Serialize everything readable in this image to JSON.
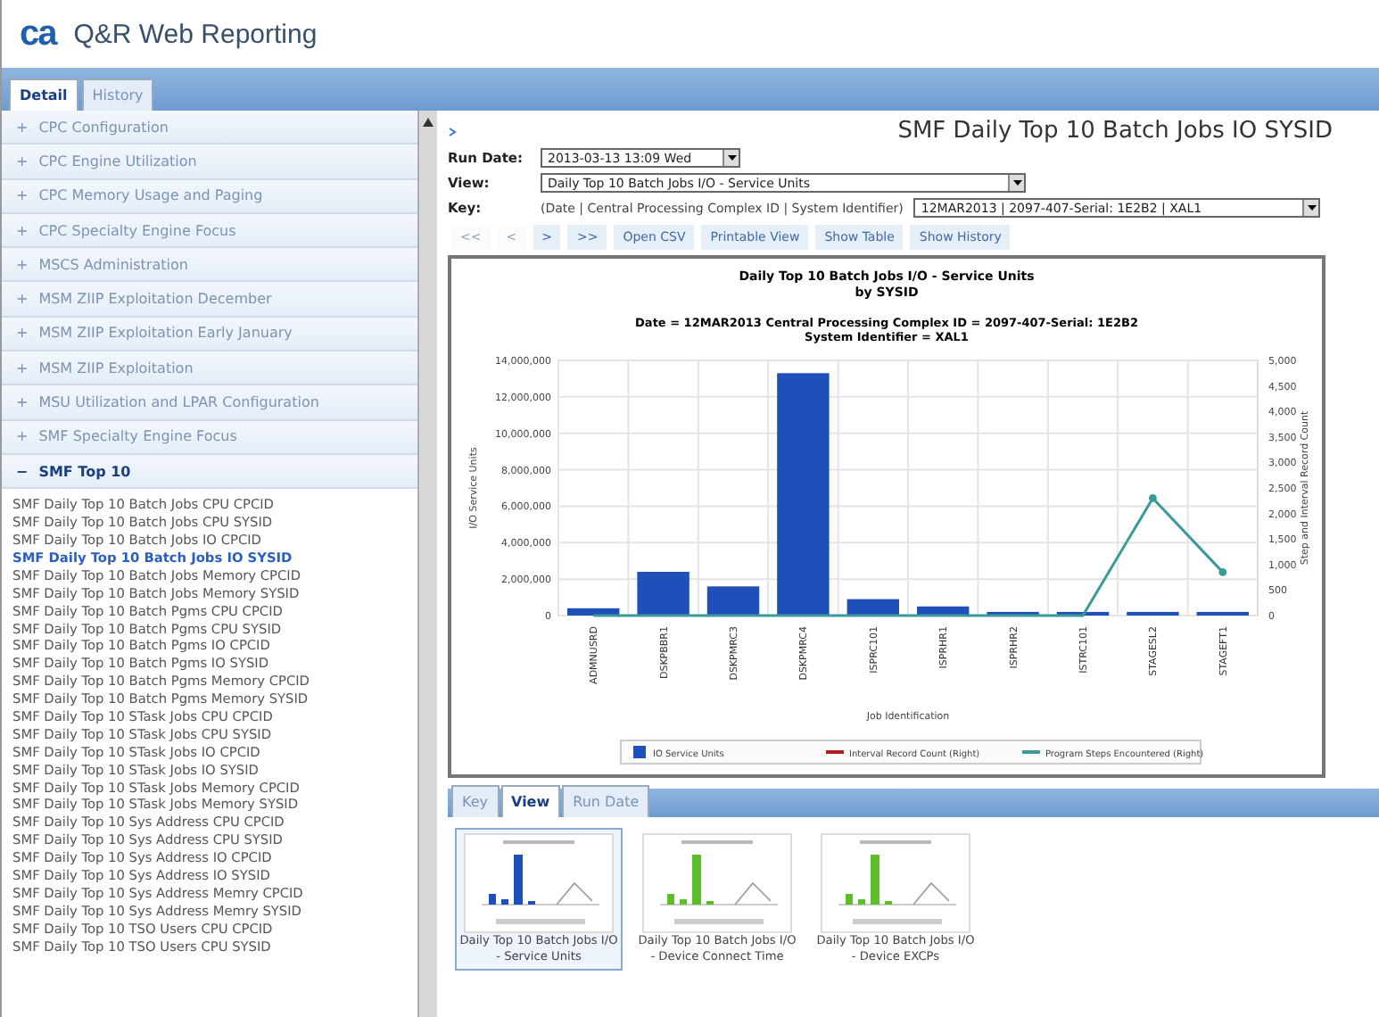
{
  "app": {
    "title": "Q&R Web Reporting",
    "logo": "ca"
  },
  "main_tabs": [
    {
      "label": "Detail",
      "selected": true
    },
    {
      "label": "History",
      "selected": false
    }
  ],
  "sidebar": {
    "groups": [
      {
        "label": "CPC Configuration",
        "expanded": false,
        "marker": "+"
      },
      {
        "label": "CPC Engine Utilization",
        "expanded": false,
        "marker": "+"
      },
      {
        "label": "CPC Memory Usage and Paging",
        "expanded": false,
        "marker": "+"
      },
      {
        "label": "CPC Specialty Engine Focus",
        "expanded": false,
        "marker": "+"
      },
      {
        "label": "MSCS Administration",
        "expanded": false,
        "marker": "+"
      },
      {
        "label": "MSM ZIIP Exploitation December",
        "expanded": false,
        "marker": "+"
      },
      {
        "label": "MSM ZIIP Exploitation Early January",
        "expanded": false,
        "marker": "+"
      },
      {
        "label": "MSM ZIIP Exploitation",
        "expanded": false,
        "marker": "+"
      },
      {
        "label": "MSU Utilization and LPAR Configuration",
        "expanded": false,
        "marker": "+"
      },
      {
        "label": "SMF Specialty Engine Focus",
        "expanded": false,
        "marker": "+"
      },
      {
        "label": "SMF Top 10",
        "expanded": true,
        "marker": "−",
        "children": [
          {
            "label": "SMF Daily Top 10 Batch Jobs CPU CPCID",
            "selected": false
          },
          {
            "label": "SMF Daily Top 10 Batch Jobs CPU SYSID",
            "selected": false
          },
          {
            "label": "SMF Daily Top 10 Batch Jobs IO CPCID",
            "selected": false
          },
          {
            "label": "SMF Daily Top 10 Batch Jobs IO SYSID",
            "selected": true
          },
          {
            "label": "SMF Daily Top 10 Batch Jobs Memory CPCID",
            "selected": false
          },
          {
            "label": "SMF Daily Top 10 Batch Jobs Memory SYSID",
            "selected": false
          },
          {
            "label": "SMF Daily Top 10 Batch Pgms CPU CPCID",
            "selected": false
          },
          {
            "label": "SMF Daily Top 10 Batch Pgms CPU SYSID",
            "selected": false
          },
          {
            "label": "SMF Daily Top 10 Batch Pgms IO CPCID",
            "selected": false
          },
          {
            "label": "SMF Daily Top 10 Batch Pgms IO SYSID",
            "selected": false
          },
          {
            "label": "SMF Daily Top 10 Batch Pgms Memory CPCID",
            "selected": false
          },
          {
            "label": "SMF Daily Top 10 Batch Pgms Memory SYSID",
            "selected": false
          },
          {
            "label": "SMF Daily Top 10 STask Jobs CPU CPCID",
            "selected": false
          },
          {
            "label": "SMF Daily Top 10 STask Jobs CPU SYSID",
            "selected": false
          },
          {
            "label": "SMF Daily Top 10 STask Jobs IO CPCID",
            "selected": false
          },
          {
            "label": "SMF Daily Top 10 STask Jobs IO SYSID",
            "selected": false
          },
          {
            "label": "SMF Daily Top 10 STask Jobs Memory CPCID",
            "selected": false
          },
          {
            "label": "SMF Daily Top 10 STask Jobs Memory SYSID",
            "selected": false
          },
          {
            "label": "SMF Daily Top 10 Sys Address CPU CPCID",
            "selected": false
          },
          {
            "label": "SMF Daily Top 10 Sys Address CPU SYSID",
            "selected": false
          },
          {
            "label": "SMF Daily Top 10 Sys Address IO CPCID",
            "selected": false
          },
          {
            "label": "SMF Daily Top 10 Sys Address IO SYSID",
            "selected": false
          },
          {
            "label": "SMF Daily Top 10 Sys Address Memry CPCID",
            "selected": false
          },
          {
            "label": "SMF Daily Top 10 Sys Address Memry SYSID",
            "selected": false
          },
          {
            "label": "SMF Daily Top 10 TSO Users CPU CPCID",
            "selected": false
          },
          {
            "label": "SMF Daily Top 10 TSO Users CPU SYSID",
            "selected": false
          }
        ]
      }
    ]
  },
  "report": {
    "title": "SMF Daily Top 10 Batch Jobs IO SYSID",
    "run_date": {
      "label": "Run Date:",
      "value": "2013-03-13 13:09 Wed"
    },
    "view": {
      "label": "View:",
      "value": "Daily Top 10 Batch Jobs I/O - Service Units"
    },
    "key": {
      "label": "Key:",
      "hint": "(Date | Central Processing Complex ID | System Identifier)",
      "value": "12MAR2013 | 2097-407-Serial: 1E2B2 | XAL1"
    },
    "toolbar": [
      {
        "label": "<<",
        "disabled": true
      },
      {
        "label": "<",
        "disabled": true
      },
      {
        "label": ">",
        "disabled": false
      },
      {
        "label": ">>",
        "disabled": false
      },
      {
        "label": "Open CSV",
        "disabled": false
      },
      {
        "label": "Printable View",
        "disabled": false
      },
      {
        "label": "Show Table",
        "disabled": false
      },
      {
        "label": "Show History",
        "disabled": false
      }
    ],
    "chart": {
      "chart_data": {
        "type": "bar",
        "title": "Daily Top 10 Batch Jobs I/O - Service Units\nby SYSID",
        "subtitle": "Date = 12MAR2013 Central Processing Complex ID = 2097-407-Serial: 1E2B2\nSystem Identifier = XAL1",
        "xlabel": "Job Identification",
        "ylabel": "I/O Service Units",
        "y2label": "Step and Interval Record Count",
        "categories": [
          "ADMNUSRD",
          "DSKPBBR1",
          "DSKPMRC3",
          "DSKPMRC4",
          "ISPRC101",
          "ISPRHR1",
          "ISPRHR2",
          "ISTRC101",
          "STAGESL2",
          "STAGEFT1"
        ],
        "series": [
          {
            "name": "IO Service Units",
            "color": "#1f4fb8",
            "values": [
              400000,
              2400000,
              1600000,
              13300000,
              900000,
              500000,
              200000,
              200000,
              200000,
              200000
            ]
          },
          {
            "name": "Interval Record Count (Right)",
            "color": "#b02020",
            "type": "line",
            "axis": "y2",
            "values": [
              null,
              null,
              null,
              null,
              null,
              null,
              null,
              null,
              null,
              null
            ]
          },
          {
            "name": "Program Steps Encountered (Right)",
            "color": "#3a9a9a",
            "type": "line",
            "axis": "y2",
            "values": [
              0,
              0,
              0,
              0,
              0,
              0,
              0,
              0,
              2300,
              850
            ]
          }
        ],
        "grid": true,
        "legend": true,
        "ylim": [
          0,
          14000000
        ],
        "y2lim": [
          0,
          5000
        ],
        "yticks": [
          {
            "value": 0,
            "label": "0"
          },
          {
            "value": 2000000,
            "label": "2,000,000"
          },
          {
            "value": 4000000,
            "label": "4,000,000"
          },
          {
            "value": 6000000,
            "label": "6,000,000"
          },
          {
            "value": 8000000,
            "label": "8,000,000"
          },
          {
            "value": 10000000,
            "label": "10,000,000"
          },
          {
            "value": 12000000,
            "label": "12,000,000"
          },
          {
            "value": 14000000,
            "label": "14,000,000"
          }
        ],
        "y2ticks": [
          {
            "value": 0,
            "label": "0"
          },
          {
            "value": 500,
            "label": "500"
          },
          {
            "value": 1000,
            "label": "1,000"
          },
          {
            "value": 1500,
            "label": "1,500"
          },
          {
            "value": 2000,
            "label": "2,000"
          },
          {
            "value": 2500,
            "label": "2,500"
          },
          {
            "value": 3000,
            "label": "3,000"
          },
          {
            "value": 3500,
            "label": "3,500"
          },
          {
            "value": 4000,
            "label": "4,000"
          },
          {
            "value": 4500,
            "label": "4,500"
          },
          {
            "value": 5000,
            "label": "5,000"
          }
        ]
      }
    },
    "bottom_tabs": [
      {
        "label": "Key",
        "selected": false
      },
      {
        "label": "View",
        "selected": true
      },
      {
        "label": "Run Date",
        "selected": false
      }
    ],
    "thumbnails": [
      {
        "label": "Daily Top 10 Batch Jobs I/O - Service Units",
        "selected": true,
        "color": "#1f4fb8"
      },
      {
        "label": "Daily Top 10 Batch Jobs I/O - Device Connect Time",
        "selected": false,
        "color": "#5cbf2a"
      },
      {
        "label": "Daily Top 10 Batch Jobs I/O - Device EXCPs",
        "selected": false,
        "color": "#5cbf2a"
      }
    ]
  }
}
